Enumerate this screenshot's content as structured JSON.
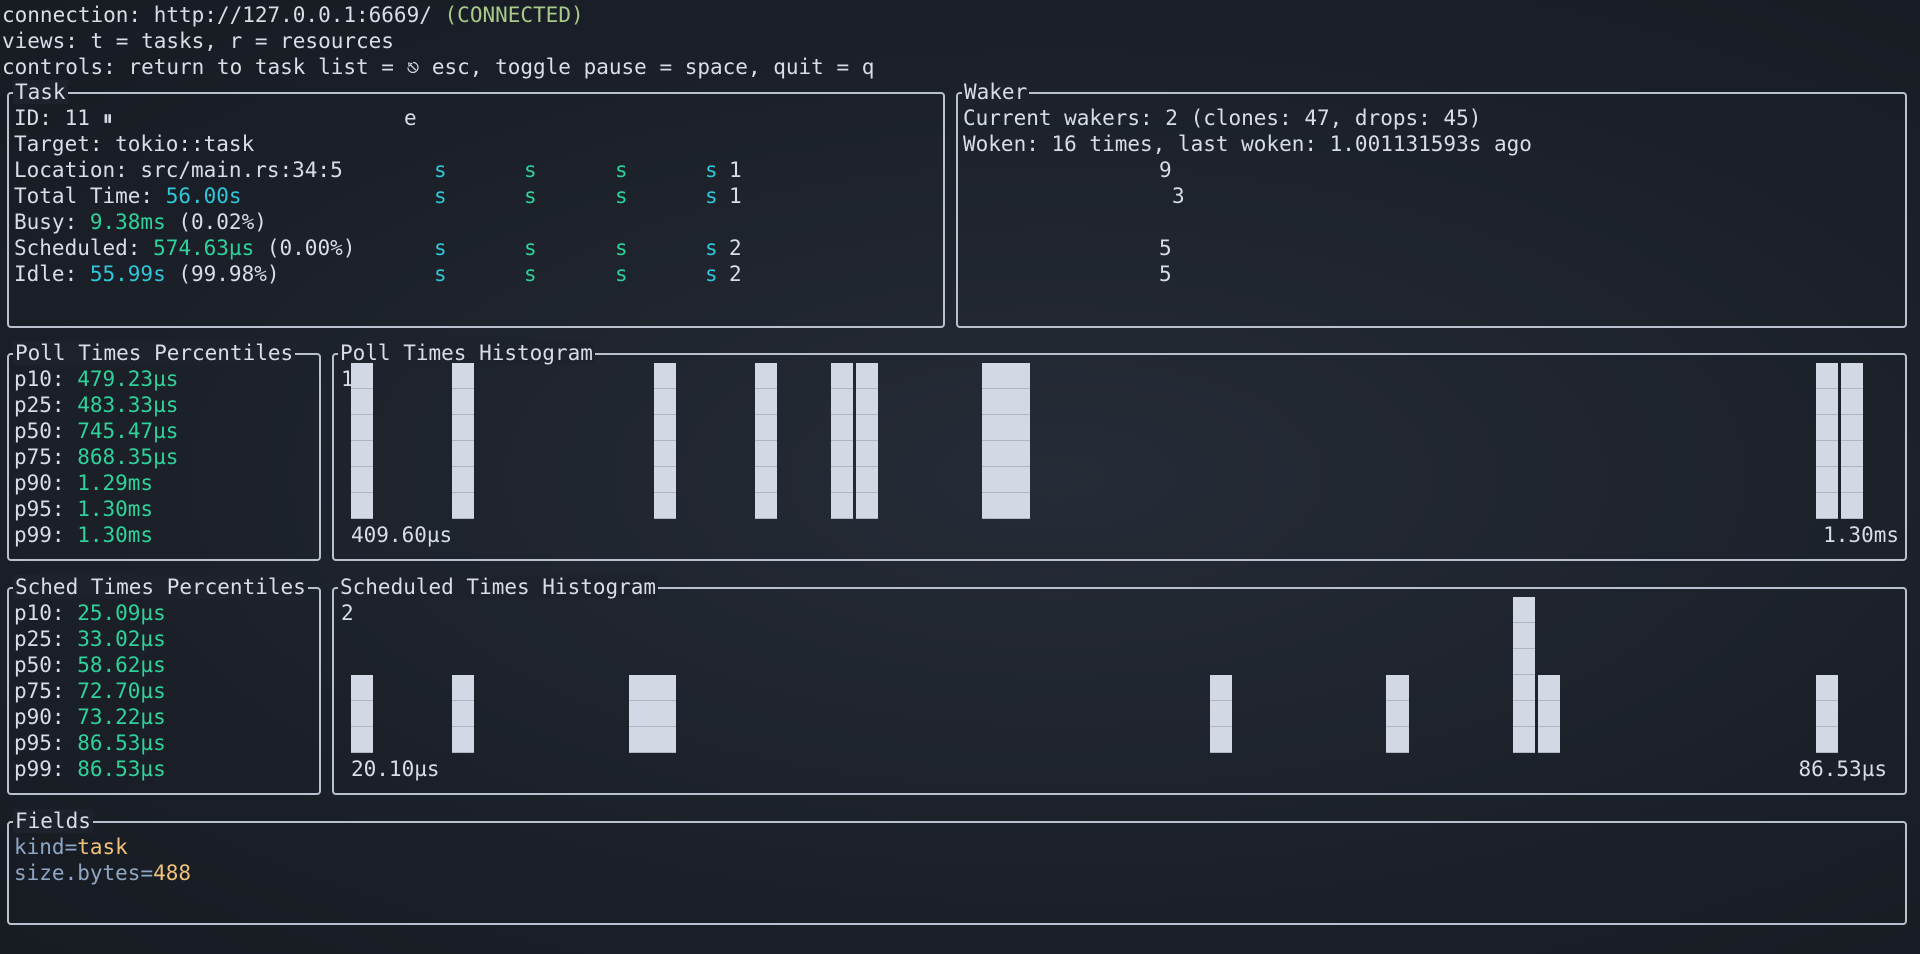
{
  "header": {
    "connection_label": "connection: ",
    "connection_url": "http://127.0.0.1:6669/",
    "connection_status": "(CONNECTED)",
    "views": "views: t = tasks, r = resources",
    "controls_prefix": "controls: return to task list = ",
    "controls_icon": "⎋",
    "controls_suffix": " esc, toggle pause = space, quit = q"
  },
  "task": {
    "title": "Task",
    "id_label": "ID: 11 ",
    "pause_icon": "⏸",
    "overlay_char": "e",
    "target": "Target: tokio::task",
    "location": "Location: src/main.rs:34:5",
    "total_label": "Total Time: ",
    "total_value": "56.00s",
    "busy_label": "Busy: ",
    "busy_value": "9.38ms",
    "busy_pct": " (0.02%)",
    "sched_label": "Scheduled: ",
    "sched_value": "574.63µs",
    "sched_pct": " (0.00%)",
    "idle_label": "Idle: ",
    "idle_value": "55.99s",
    "idle_pct": " (99.98%)",
    "overlay_s": "s",
    "overlay_nums": [
      "1",
      "1",
      "2",
      "2"
    ]
  },
  "waker": {
    "title": "Waker",
    "current": "Current wakers: 2 (clones: 47, drops: 45)",
    "woken": "Woken: 16 times, last woken: 1.001131593s ago",
    "overlay_nums": [
      "9",
      "3",
      "5",
      "5"
    ]
  },
  "poll_percentiles": {
    "title": "Poll Times Percentiles",
    "rows": [
      {
        "label": "p10: ",
        "value": "479.23µs"
      },
      {
        "label": "p25: ",
        "value": "483.33µs"
      },
      {
        "label": "p50: ",
        "value": "745.47µs"
      },
      {
        "label": "p75: ",
        "value": "868.35µs"
      },
      {
        "label": "p90: ",
        "value": "1.29ms"
      },
      {
        "label": "p95: ",
        "value": "1.30ms"
      },
      {
        "label": "p99: ",
        "value": "1.30ms"
      }
    ]
  },
  "sched_percentiles": {
    "title": "Sched Times Percentiles",
    "rows": [
      {
        "label": "p10: ",
        "value": "25.09µs"
      },
      {
        "label": "p25: ",
        "value": "33.02µs"
      },
      {
        "label": "p50: ",
        "value": "58.62µs"
      },
      {
        "label": "p75: ",
        "value": "72.70µs"
      },
      {
        "label": "p90: ",
        "value": "73.22µs"
      },
      {
        "label": "p95: ",
        "value": "86.53µs"
      },
      {
        "label": "p99: ",
        "value": "86.53µs"
      }
    ]
  },
  "fields": {
    "title": "Fields",
    "items": [
      {
        "key": "kind",
        "eq": "=",
        "value": "task"
      },
      {
        "key": "size.bytes",
        "eq": "=",
        "value": "488"
      }
    ]
  },
  "colors": {
    "background": "#1b2029",
    "text": "#d8dde8",
    "border": "#b9c1cf",
    "green": "#2fd39a",
    "cyan": "#2fc7d9",
    "bar": "#d3d9e4",
    "field_key": "#8fa7c4",
    "field_value": "#f0c27a"
  },
  "chart_data": [
    {
      "type": "bar",
      "title": "Poll Times Histogram",
      "max_label": "1",
      "x_min_label": "409.60µs",
      "x_max_label": "1.30ms",
      "bins": 60,
      "ylim": [
        0,
        1
      ],
      "values": [
        1,
        0,
        0,
        0,
        1,
        0,
        0,
        0,
        0,
        0,
        0,
        0,
        1,
        0,
        0,
        0,
        1,
        0,
        0,
        1,
        1,
        0,
        0,
        0,
        0,
        1,
        0,
        0,
        0,
        0,
        0,
        0,
        0,
        0,
        0,
        0,
        0,
        0,
        0,
        0,
        0,
        0,
        0,
        0,
        0,
        0,
        0,
        0,
        0,
        0,
        0,
        0,
        0,
        0,
        0,
        0,
        0,
        0,
        1,
        1
      ],
      "bar_spans": [
        [
          0,
          0
        ],
        [
          4,
          4
        ],
        [
          12,
          12
        ],
        [
          16,
          16
        ],
        [
          19,
          19
        ],
        [
          20,
          20
        ],
        [
          25,
          26
        ],
        [
          58,
          58
        ],
        [
          59,
          59
        ]
      ]
    },
    {
      "type": "bar",
      "title": "Scheduled Times Histogram",
      "max_label": "2",
      "x_min_label": "20.10µs",
      "x_max_label": "86.53µs",
      "ylim": [
        0,
        2
      ],
      "bars": [
        {
          "bin_start": 0,
          "bin_end": 0,
          "value": 1
        },
        {
          "bin_start": 4,
          "bin_end": 4,
          "value": 1
        },
        {
          "bin_start": 11,
          "bin_end": 12,
          "value": 1
        },
        {
          "bin_start": 34,
          "bin_end": 34,
          "value": 1
        },
        {
          "bin_start": 41,
          "bin_end": 41,
          "value": 1
        },
        {
          "bin_start": 46,
          "bin_end": 46,
          "value": 2
        },
        {
          "bin_start": 47,
          "bin_end": 47,
          "value": 1
        },
        {
          "bin_start": 58,
          "bin_end": 58,
          "value": 1
        }
      ]
    }
  ]
}
